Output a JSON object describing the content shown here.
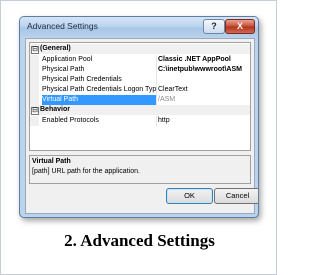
{
  "dialog": {
    "title": "Advanced Settings",
    "help_glyph": "?",
    "close_glyph": "X"
  },
  "grid": {
    "general": {
      "toggle": "⊟",
      "label": "(General)",
      "rows": [
        {
          "name": "Application Pool",
          "value": "Classic .NET AppPool"
        },
        {
          "name": "Physical Path",
          "value": "C:\\inetpub\\wwwroot\\ASM"
        },
        {
          "name": "Physical Path Credentials",
          "value": ""
        },
        {
          "name": "Physical Path Credentials Logon Type",
          "value": "ClearText"
        },
        {
          "name": "Virtual Path",
          "value": "/ASM"
        }
      ]
    },
    "behavior": {
      "toggle": "⊟",
      "label": "Behavior",
      "rows": [
        {
          "name": "Enabled Protocols",
          "value": "http"
        }
      ]
    }
  },
  "description": {
    "title": "Virtual Path",
    "text": "[path] URL path for the application."
  },
  "buttons": {
    "ok": "OK",
    "cancel": "Cancel"
  },
  "caption": "2. Advanced Settings"
}
